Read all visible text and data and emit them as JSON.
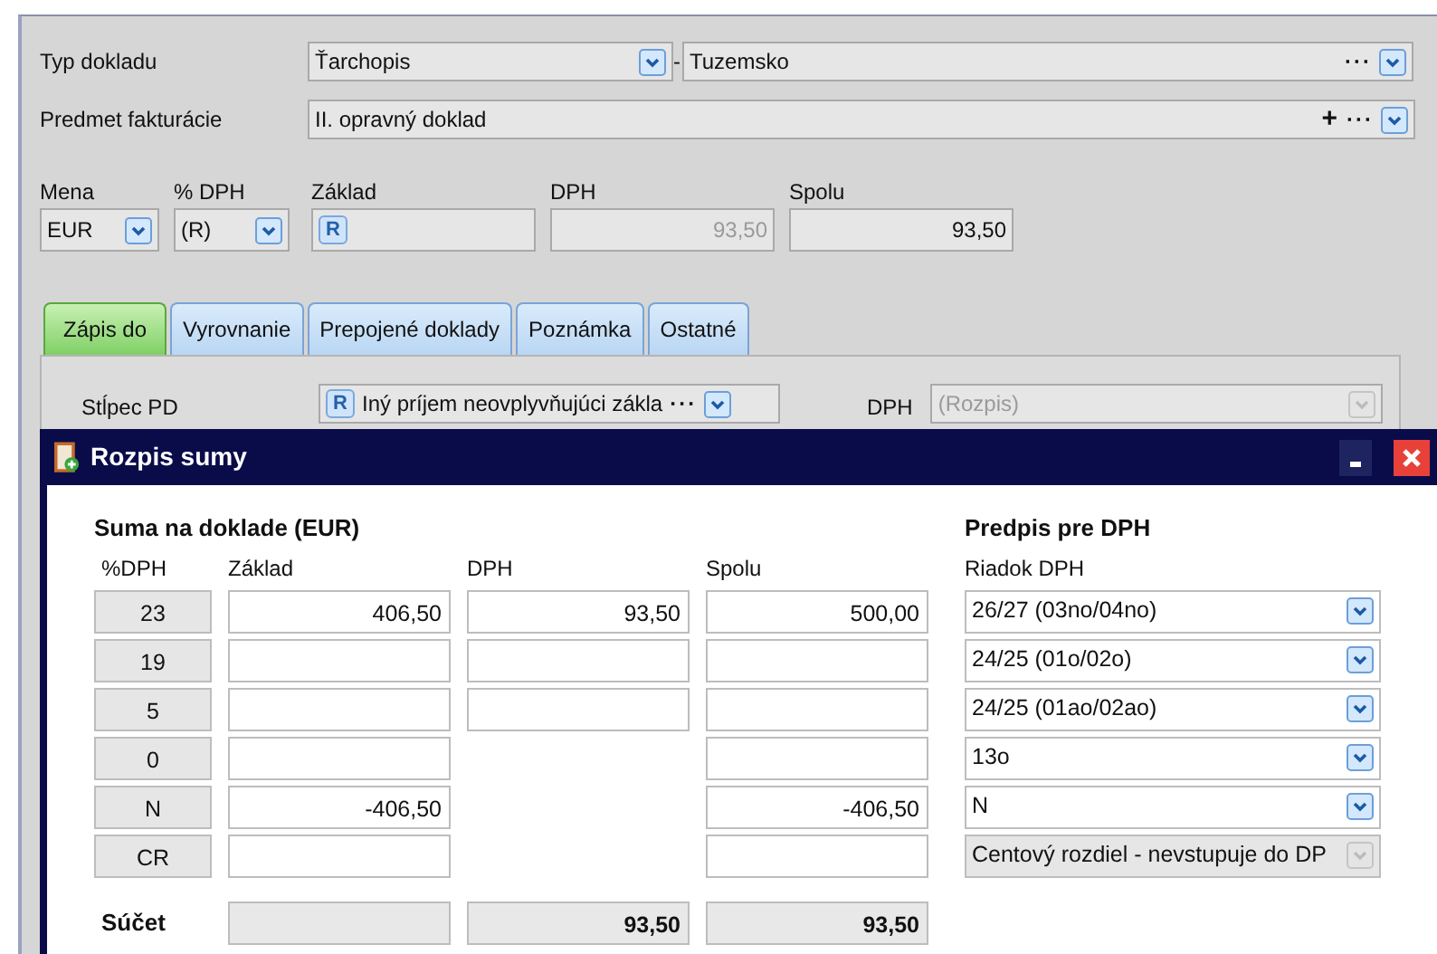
{
  "document_type": {
    "label": "Typ dokladu",
    "value": "Ťarchopis",
    "separator": "-",
    "sub_value": "Tuzemsko",
    "more": "···"
  },
  "billing_subject": {
    "label": "Predmet fakturácie",
    "value": "II. opravný doklad",
    "add": "+",
    "more": "···"
  },
  "amounts": [
    {
      "label": "Mena",
      "value": "EUR",
      "kind": "select"
    },
    {
      "label": "% DPH",
      "value": "(R)",
      "kind": "select"
    },
    {
      "label": "Základ",
      "badge": "R",
      "kind": "readonly"
    },
    {
      "label": "DPH",
      "value": "93,50",
      "kind": "readonly",
      "disabled": true
    },
    {
      "label": "Spolu",
      "value": "93,50",
      "kind": "readonly",
      "disabled": false
    }
  ],
  "tabs": [
    {
      "label": "Zápis do",
      "selected": true
    },
    {
      "label": "Vyrovnanie",
      "selected": false
    },
    {
      "label": "Prepojené doklady",
      "selected": false
    },
    {
      "label": "Poznámka",
      "selected": false
    },
    {
      "label": "Ostatné",
      "selected": false
    }
  ],
  "tab_panel": {
    "column_label": "Stĺpec PD",
    "column_badge": "R",
    "column_value": "Iný príjem neovplyvňujúci zákla",
    "column_more": "···",
    "vat_label": "DPH",
    "vat_value": "(Rozpis)",
    "vat_disabled": true
  },
  "dialog": {
    "title": "Rozpis sumy",
    "section_title": "Suma na doklade (EUR)",
    "columns": [
      "%DPH",
      "Základ",
      "DPH",
      "Spolu"
    ],
    "right_title": "Predpis pre DPH",
    "right_column": "Riadok DPH",
    "rows": [
      {
        "rate": "23",
        "base": "406,50",
        "kind": "with_vat",
        "vat": "93,50",
        "total": "500,00",
        "line": "26/27 (03no/04no)",
        "line_disabled": false
      },
      {
        "rate": "19",
        "kind": "with_vat",
        "line": "24/25 (01o/02o)",
        "line_disabled": false
      },
      {
        "rate": "5",
        "kind": "with_vat",
        "line": "24/25 (01ao/02ao)",
        "line_disabled": false
      },
      {
        "rate": "0",
        "kind": "no_vat",
        "line": "13o",
        "line_disabled": false
      },
      {
        "rate": "N",
        "base": "-406,50",
        "kind": "no_vat",
        "total": "-406,50",
        "line": "N",
        "line_disabled": false
      },
      {
        "rate": "CR",
        "kind": "no_vat",
        "line": "Centový rozdiel - nevstupuje do DP",
        "line_disabled": true
      }
    ],
    "sum": {
      "label": "Súčet",
      "vat": "93,50",
      "total": "93,50"
    }
  }
}
